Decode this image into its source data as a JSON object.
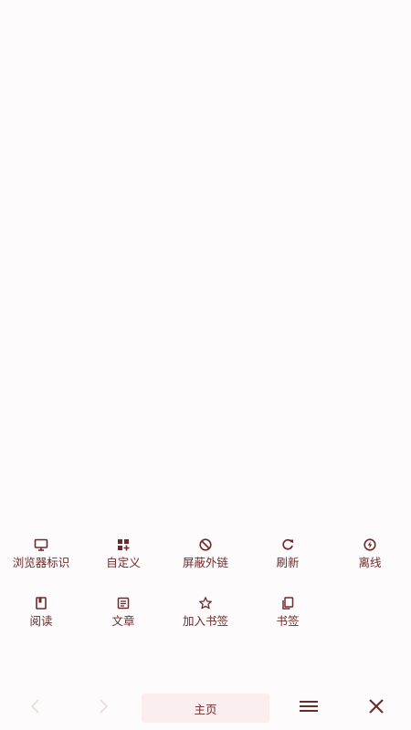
{
  "menu": {
    "row1": [
      {
        "label": "浏览器标识",
        "icon": "monitor-icon"
      },
      {
        "label": "自定义",
        "icon": "grid-plus-icon"
      },
      {
        "label": "屏蔽外链",
        "icon": "block-icon"
      },
      {
        "label": "刷新",
        "icon": "refresh-icon"
      },
      {
        "label": "离线",
        "icon": "offline-bolt-icon"
      }
    ],
    "row2": [
      {
        "label": "阅读",
        "icon": "book-icon"
      },
      {
        "label": "文章",
        "icon": "article-icon"
      },
      {
        "label": "加入书签",
        "icon": "star-icon"
      },
      {
        "label": "书签",
        "icon": "bookmarks-icon"
      }
    ]
  },
  "bottom_bar": {
    "home_label": "主页",
    "back_icon": "chevron-left-icon",
    "forward_icon": "chevron-right-icon",
    "menu_icon": "hamburger-icon",
    "close_icon": "close-icon"
  },
  "colors": {
    "accent": "#6e2a2a",
    "disabled": "#f3dcdc",
    "home_button_bg": "#fbeeee",
    "background": "#fdfbfb"
  }
}
